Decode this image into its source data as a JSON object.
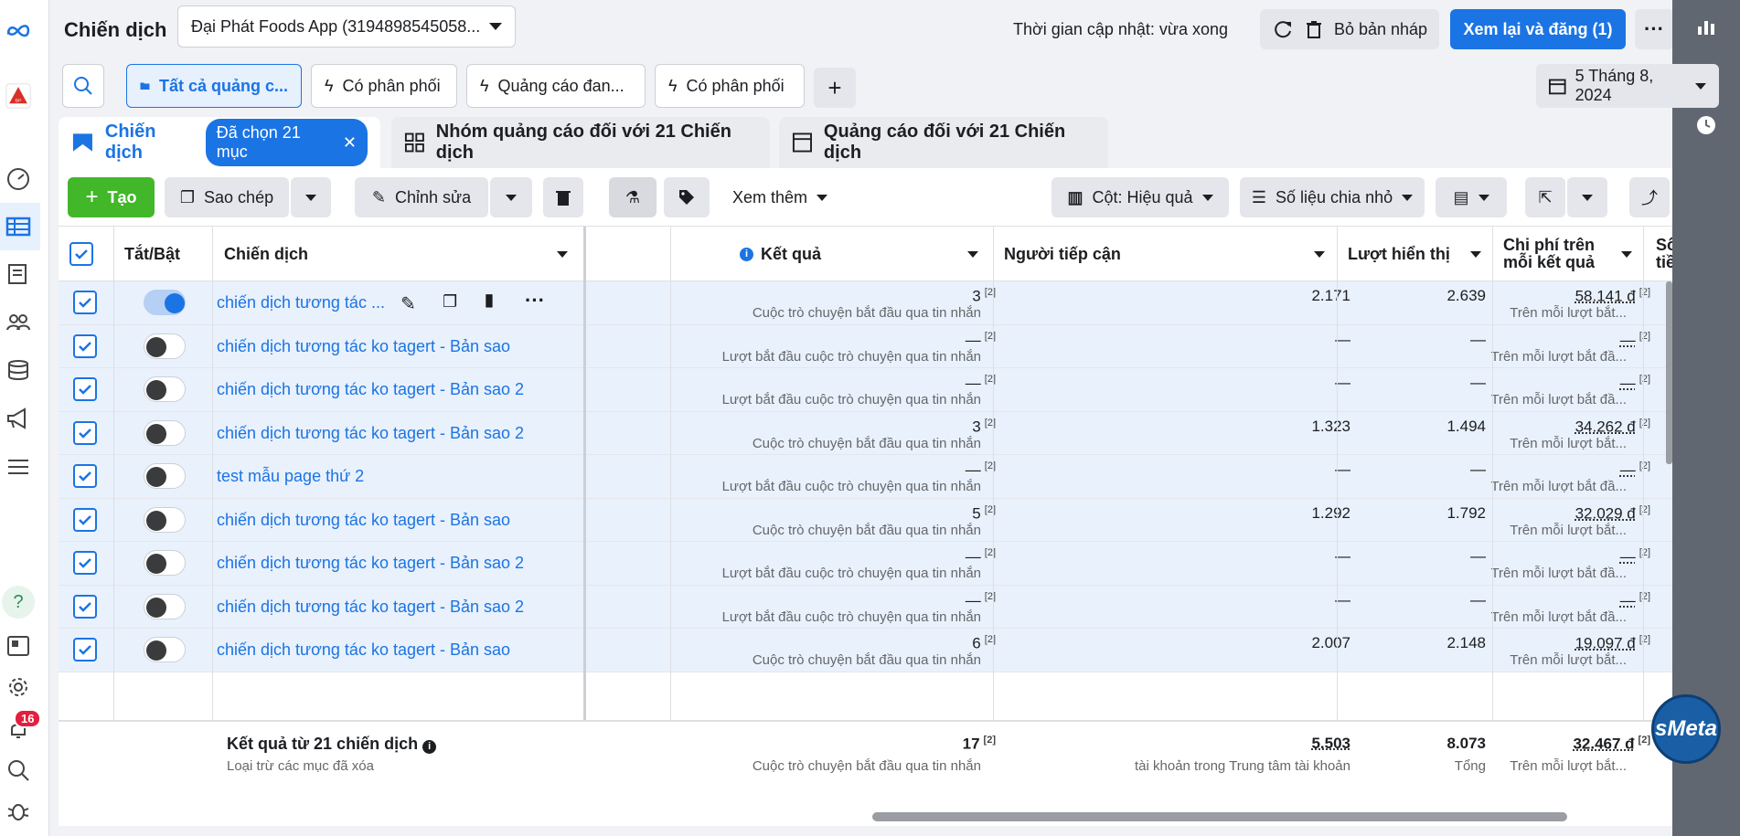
{
  "header": {
    "title": "Chiến dịch",
    "account": "Đại Phát Foods App (3194898545058...",
    "update_status": "Thời gian cập nhật: vừa xong",
    "discard_label": "Bỏ bản nháp",
    "publish_label": "Xem lại và đăng (1)"
  },
  "filters": {
    "tabs": [
      "Tất cả quảng c...",
      "Có phân phối",
      "Quảng cáo đan...",
      "Có phân phối"
    ],
    "date": "5 Tháng 8, 2024"
  },
  "level_tabs": {
    "campaigns": "Chiến dịch",
    "selected_pill": "Đã chọn 21 mục",
    "adsets": "Nhóm quảng cáo đối với 21 Chiến dịch",
    "ads": "Quảng cáo đối với 21 Chiến dịch"
  },
  "toolbar": {
    "create": "Tạo",
    "copy": "Sao chép",
    "edit": "Chỉnh sửa",
    "more": "Xem thêm",
    "columns": "Cột: Hiệu quả",
    "breakdown": "Số liệu chia nhỏ"
  },
  "columns": {
    "toggle": "Tắt/Bật",
    "campaign": "Chiến dịch",
    "results": "Kết quả",
    "reach": "Người tiếp cận",
    "impressions": "Lượt hiển thị",
    "cost_line1": "Chi phí trên",
    "cost_line2": "mỗi kết quả",
    "partial_line1": "Số",
    "partial_line2": "tiề"
  },
  "rows": [
    {
      "name": "chiến dịch tương tác ...",
      "on": true,
      "result": "3",
      "result_sub": "Cuộc trò chuyện bắt đầu qua tin nhắn",
      "reach": "2.171",
      "impr": "2.639",
      "cost": "58.141 đ",
      "cost_sub": "Trên mỗi lượt bắt..."
    },
    {
      "name": "chiến dịch tương tác ko tagert - Bản sao",
      "on": false,
      "result": "—",
      "result_sub": "Lượt bắt đầu cuộc trò chuyện qua tin nhắn",
      "reach": "—",
      "impr": "—",
      "cost": "—",
      "cost_sub": "Trên mỗi lượt bắt đầ..."
    },
    {
      "name": "chiến dịch tương tác ko tagert - Bản sao 2",
      "on": false,
      "result": "—",
      "result_sub": "Lượt bắt đầu cuộc trò chuyện qua tin nhắn",
      "reach": "—",
      "impr": "—",
      "cost": "—",
      "cost_sub": "Trên mỗi lượt bắt đầ..."
    },
    {
      "name": "chiến dịch tương tác ko tagert - Bản sao 2",
      "on": false,
      "result": "3",
      "result_sub": "Cuộc trò chuyện bắt đầu qua tin nhắn",
      "reach": "1.323",
      "impr": "1.494",
      "cost": "34.262 đ",
      "cost_sub": "Trên mỗi lượt bắt..."
    },
    {
      "name": "test mẫu page thứ 2",
      "on": false,
      "result": "—",
      "result_sub": "Lượt bắt đầu cuộc trò chuyện qua tin nhắn",
      "reach": "—",
      "impr": "—",
      "cost": "—",
      "cost_sub": "Trên mỗi lượt bắt đầ..."
    },
    {
      "name": "chiến dịch tương tác ko tagert - Bản sao",
      "on": false,
      "result": "5",
      "result_sub": "Cuộc trò chuyện bắt đầu qua tin nhắn",
      "reach": "1.292",
      "impr": "1.792",
      "cost": "32.029 đ",
      "cost_sub": "Trên mỗi lượt bắt..."
    },
    {
      "name": "chiến dịch tương tác ko tagert - Bản sao 2",
      "on": false,
      "result": "—",
      "result_sub": "Lượt bắt đầu cuộc trò chuyện qua tin nhắn",
      "reach": "—",
      "impr": "—",
      "cost": "—",
      "cost_sub": "Trên mỗi lượt bắt đầ..."
    },
    {
      "name": "chiến dịch tương tác ko tagert - Bản sao 2",
      "on": false,
      "result": "—",
      "result_sub": "Lượt bắt đầu cuộc trò chuyện qua tin nhắn",
      "reach": "—",
      "impr": "—",
      "cost": "—",
      "cost_sub": "Trên mỗi lượt bắt đầ..."
    },
    {
      "name": "chiến dịch tương tác ko tagert - Bản sao",
      "on": false,
      "result": "6",
      "result_sub": "Cuộc trò chuyện bắt đầu qua tin nhắn",
      "reach": "2.007",
      "impr": "2.148",
      "cost": "19.097 đ",
      "cost_sub": "Trên mỗi lượt bắt..."
    }
  ],
  "footnote": "[2]",
  "totals": {
    "label": "Kết quả từ 21 chiến dịch",
    "sublabel": "Loại trừ các mục đã xóa",
    "result": "17",
    "result_sub": "Cuộc trò chuyện bắt đầu qua tin nhắn",
    "reach": "5.503",
    "reach_sub": "tài khoản trong Trung tâm tài khoản",
    "impr": "8.073",
    "impr_sub": "Tổng",
    "cost": "32.467 đ",
    "cost_sub": "Trên mỗi lượt bắt..."
  },
  "nav": {
    "notifications": "16"
  },
  "colors": {
    "accent": "#1b74e4",
    "create": "#42b72a",
    "row_selected": "#e9f1fc"
  },
  "icons": [
    "meta-logo",
    "dashboard-icon",
    "table-icon",
    "pages-icon",
    "audience-icon",
    "database-icon",
    "megaphone-icon",
    "menu-icon",
    "help-icon",
    "news-icon",
    "gear-icon",
    "bell-icon",
    "search-icon",
    "bug-icon"
  ],
  "brand": "sMeta"
}
